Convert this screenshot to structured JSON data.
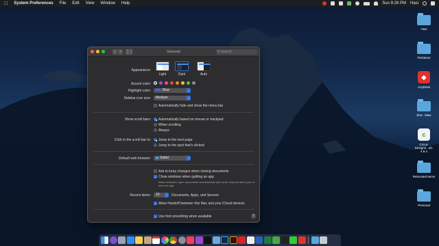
{
  "menubar": {
    "app_name": "System Preferences",
    "items": [
      "File",
      "Edit",
      "View",
      "Window",
      "Help"
    ],
    "clock": "Sun 9:26 PM",
    "user": "Hasi"
  },
  "desktop_icons": [
    {
      "label": "Hasi",
      "icon": "folder-icon"
    },
    {
      "label": "Techance",
      "icon": "folder-icon"
    },
    {
      "label": "AnyDesk",
      "icon": "anydesk-icon"
    },
    {
      "label": "Sha - iMac",
      "icon": "folder-icon"
    },
    {
      "label": "Cricut-Design3...eb-4.6.4",
      "icon": "cricut-icon"
    },
    {
      "label": "Relocated Items",
      "icon": "folder-icon"
    },
    {
      "label": "Personal",
      "icon": "folder-icon"
    }
  ],
  "window": {
    "title": "General",
    "search_placeholder": "Search",
    "appearance": {
      "label": "Appearance:",
      "options": [
        "Light",
        "Dark",
        "Auto"
      ],
      "selected": "Dark"
    },
    "accent": {
      "label": "Accent color:",
      "colors": [
        "#2f6fde",
        "#a050c8",
        "#e8508f",
        "#e14a3c",
        "#f08a24",
        "#f5c431",
        "#62ba46",
        "#8c8c8c"
      ]
    },
    "highlight": {
      "label": "Highlight color:",
      "value": "Blue"
    },
    "sidebar": {
      "label": "Sidebar icon size:",
      "value": "Medium"
    },
    "menubar_option": "Automatically hide and show the menu bar",
    "scroll_bars": {
      "label": "Show scroll bars:",
      "options": [
        "Automatically based on mouse or trackpad",
        "When scrolling",
        "Always"
      ]
    },
    "click_scroll": {
      "label": "Click in the scroll bar to:",
      "options": [
        "Jump to the next page",
        "Jump to the spot that's clicked"
      ]
    },
    "browser": {
      "label": "Default web browser:",
      "value": "Safari"
    },
    "ask_keep": "Ask to keep changes when closing documents",
    "close_windows": "Close windows when quitting an app",
    "close_note": "When selected, open documents and windows will not be restored when you re-open an app.",
    "recent": {
      "label": "Recent items:",
      "value": "10",
      "suffix": "Documents, Apps, and Servers"
    },
    "handoff": "Allow Handoff between this Mac and your iCloud devices",
    "font_smoothing": "Use font smoothing when available",
    "help": "?"
  }
}
